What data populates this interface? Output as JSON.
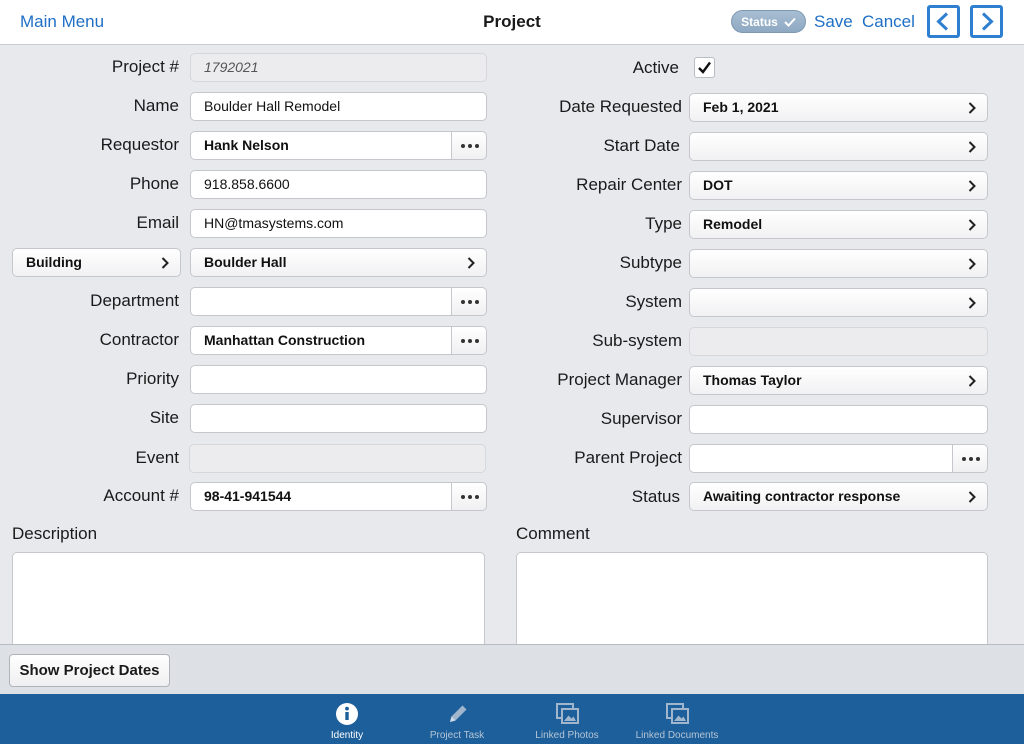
{
  "header": {
    "main_menu": "Main Menu",
    "title": "Project",
    "status_label": "Status",
    "save": "Save",
    "cancel": "Cancel"
  },
  "left": {
    "project_no_label": "Project #",
    "project_no_value": "1792021",
    "name_label": "Name",
    "name_value": "Boulder Hall Remodel",
    "requestor_label": "Requestor",
    "requestor_value": "Hank Nelson",
    "phone_label": "Phone",
    "phone_value": "918.858.6600",
    "email_label": "Email",
    "email_value": "HN@tmasystems.com",
    "building_button": "Building",
    "building_value": "Boulder Hall",
    "department_label": "Department",
    "department_value": "",
    "contractor_label": "Contractor",
    "contractor_value": "Manhattan Construction",
    "priority_label": "Priority",
    "priority_value": "",
    "site_label": "Site",
    "site_value": "",
    "event_label": "Event",
    "event_value": "",
    "account_label": "Account #",
    "account_value": "98-41-941544"
  },
  "right": {
    "active_label": "Active",
    "active_checked": true,
    "date_requested_label": "Date Requested",
    "date_requested_value": "Feb 1, 2021",
    "start_date_label": "Start Date",
    "start_date_value": "",
    "repair_center_label": "Repair Center",
    "repair_center_value": "DOT",
    "type_label": "Type",
    "type_value": "Remodel",
    "subtype_label": "Subtype",
    "subtype_value": "",
    "system_label": "System",
    "system_value": "",
    "subsystem_label": "Sub-system",
    "subsystem_value": "",
    "project_manager_label": "Project Manager",
    "project_manager_value": "Thomas Taylor",
    "supervisor_label": "Supervisor",
    "supervisor_value": "",
    "parent_project_label": "Parent Project",
    "parent_project_value": "",
    "status_label": "Status",
    "status_value": "Awaiting contractor response"
  },
  "description_label": "Description",
  "comment_label": "Comment",
  "show_dates_button": "Show Project Dates",
  "tabs": [
    {
      "label": "Identity",
      "icon": "info-icon",
      "active": true
    },
    {
      "label": "Project Task",
      "icon": "pencil-icon",
      "active": false
    },
    {
      "label": "Linked Photos",
      "icon": "photos-icon",
      "active": false
    },
    {
      "label": "Linked Documents",
      "icon": "documents-icon",
      "active": false
    }
  ],
  "colors": {
    "accent": "#1f6fc5",
    "tabbar": "#1d5f9a",
    "background": "#e8e9ed"
  }
}
